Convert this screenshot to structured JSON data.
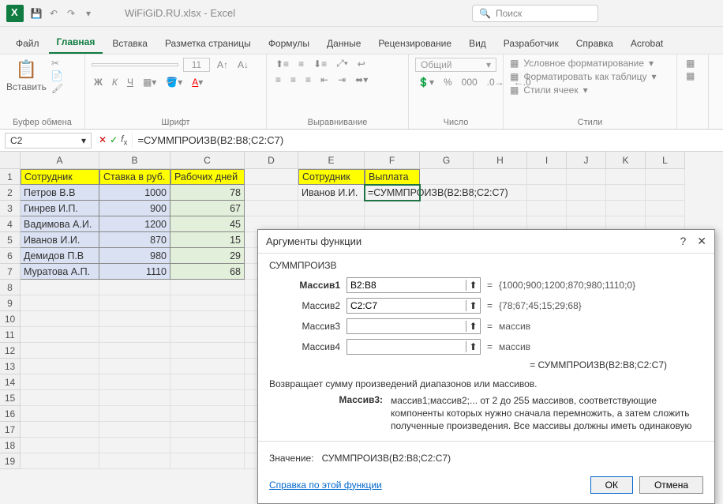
{
  "titlebar": {
    "filename": "WiFiGiD.RU.xlsx - Excel",
    "search_placeholder": "Поиск"
  },
  "menu": {
    "file": "Файл",
    "home": "Главная",
    "insert": "Вставка",
    "page_layout": "Разметка страницы",
    "formulas": "Формулы",
    "data": "Данные",
    "review": "Рецензирование",
    "view": "Вид",
    "developer": "Разработчик",
    "help": "Справка",
    "acrobat": "Acrobat"
  },
  "ribbon": {
    "clipboard": {
      "paste": "Вставить",
      "label": "Буфер обмена"
    },
    "font": {
      "label": "Шрифт",
      "size": "11",
      "bold": "Ж",
      "italic": "К",
      "underline": "Ч"
    },
    "align": {
      "label": "Выравнивание"
    },
    "number": {
      "label": "Число",
      "format": "Общий"
    },
    "styles": {
      "label": "Стили",
      "cond": "Условное форматирование",
      "table": "Форматировать как таблицу",
      "cells": "Стили ячеек"
    }
  },
  "namebox": "C2",
  "formula": "=СУММПРОИЗВ(B2:B8;C2:C7)",
  "columns": [
    "A",
    "B",
    "C",
    "D",
    "E",
    "F",
    "G",
    "H",
    "I",
    "J",
    "K",
    "L"
  ],
  "rows_header": [
    "1",
    "2",
    "3",
    "4",
    "5",
    "6",
    "7",
    "8",
    "9",
    "10",
    "11",
    "12",
    "13",
    "14",
    "15",
    "16",
    "17",
    "18",
    "19"
  ],
  "sheet": {
    "headers": {
      "a": "Сотрудник",
      "b": "Ставка в руб.",
      "c": "Рабочих дней",
      "e": "Сотрудник",
      "f": "Выплата"
    },
    "data": [
      {
        "a": "Петров В.В",
        "b": "1000",
        "c": "78"
      },
      {
        "a": "Гинрев И.П.",
        "b": "900",
        "c": "67"
      },
      {
        "a": "Вадимова А.И.",
        "b": "1200",
        "c": "45"
      },
      {
        "a": "Иванов И.И.",
        "b": "870",
        "c": "15"
      },
      {
        "a": "Демидов П.В",
        "b": "980",
        "c": "29"
      },
      {
        "a": "Муратова А.П.",
        "b": "1110",
        "c": "68"
      }
    ],
    "e2": "Иванов И.И.",
    "f2": "=СУММПРОИЗВ(B2:B8;C2:C7)"
  },
  "dialog": {
    "title": "Аргументы функции",
    "fn": "СУММПРОИЗВ",
    "args": [
      {
        "label": "Массив1",
        "bold": true,
        "value": "B2:B8",
        "result": "{1000;900;1200;870;980;1110;0}"
      },
      {
        "label": "Массив2",
        "bold": false,
        "value": "C2:C7",
        "result": "{78;67;45;15;29;68}"
      },
      {
        "label": "Массив3",
        "bold": false,
        "value": "",
        "result": "массив"
      },
      {
        "label": "Массив4",
        "bold": false,
        "value": "",
        "result": "массив"
      }
    ],
    "preview_eq": "= СУММПРОИЗВ(B2:B8;C2:C7)",
    "desc": "Возвращает сумму произведений диапазонов или массивов.",
    "arg_desc_label": "Массив3:",
    "arg_desc_text": "массив1;массив2;... от 2 до 255 массивов, соответствующие компоненты которых нужно сначала перемножить, а затем сложить полученные произведения. Все массивы должны иметь одинаковую",
    "value_label": "Значение:",
    "value_text": "СУММПРОИЗВ(B2:B8;C2:C7)",
    "help_link": "Справка по этой функции",
    "ok": "ОК",
    "cancel": "Отмена"
  }
}
